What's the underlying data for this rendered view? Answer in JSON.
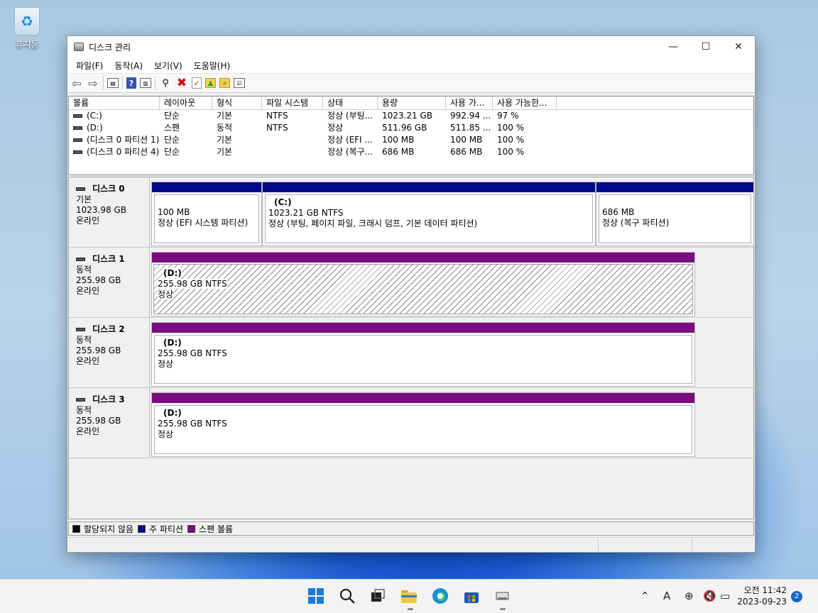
{
  "desktop": {
    "recycle_label": "휴지통"
  },
  "window": {
    "title": "디스크 관리",
    "menu": [
      "파일(F)",
      "동작(A)",
      "보기(V)",
      "도움말(H)"
    ],
    "volume_columns": [
      "볼륨",
      "레이아웃",
      "형식",
      "파일 시스템",
      "상태",
      "용량",
      "사용 가...",
      "사용 가능한..."
    ],
    "volumes": [
      [
        "(C:)",
        "단순",
        "기본",
        "NTFS",
        "정상 (부팅...",
        "1023.21 GB",
        "992.94 ...",
        "97 %"
      ],
      [
        "(D:)",
        "스팬",
        "동적",
        "NTFS",
        "정상",
        "511.96 GB",
        "511.85 ...",
        "100 %"
      ],
      [
        "(디스크 0 파티션 1)",
        "단순",
        "기본",
        "",
        "정상 (EFI ...",
        "100 MB",
        "100 MB",
        "100 %"
      ],
      [
        "(디스크 0 파티션 4)",
        "단순",
        "기본",
        "",
        "정상 (복구...",
        "686 MB",
        "686 MB",
        "100 %"
      ]
    ],
    "disks": [
      {
        "name": "디스크 0",
        "type": "기본",
        "size": "1023.98 GB",
        "status": "온라인",
        "parts": [
          {
            "name": "",
            "size": "100 MB",
            "status": "정상 (EFI 시스템 파티션)"
          },
          {
            "name": "(C:)",
            "size": "1023.21 GB NTFS",
            "status": "정상 (부팅, 페이지 파일, 크래시 덤프, 기본 데이터 파티션)"
          },
          {
            "name": "",
            "size": "686 MB",
            "status": "정상 (복구 파티션)"
          }
        ]
      },
      {
        "name": "디스크 1",
        "type": "동적",
        "size": "255.98 GB",
        "status": "온라인",
        "parts": [
          {
            "name": "(D:)",
            "size": "255.98 GB NTFS",
            "status": "정상"
          }
        ]
      },
      {
        "name": "디스크 2",
        "type": "동적",
        "size": "255.98 GB",
        "status": "온라인",
        "parts": [
          {
            "name": "(D:)",
            "size": "255.98 GB NTFS",
            "status": "정상"
          }
        ]
      },
      {
        "name": "디스크 3",
        "type": "동적",
        "size": "255.98 GB",
        "status": "온라인",
        "parts": [
          {
            "name": "(D:)",
            "size": "255.98 GB NTFS",
            "status": "정상"
          }
        ]
      }
    ],
    "legend": [
      {
        "label": "할당되지 않음",
        "color": "#000000"
      },
      {
        "label": "주 파티션",
        "color": "#000b8b"
      },
      {
        "label": "스팬 볼륨",
        "color": "#7a0c7f"
      }
    ]
  },
  "taskbar": {
    "time": "오전 11:42",
    "date": "2023-09-23",
    "notifications": "2",
    "ime": "A"
  }
}
